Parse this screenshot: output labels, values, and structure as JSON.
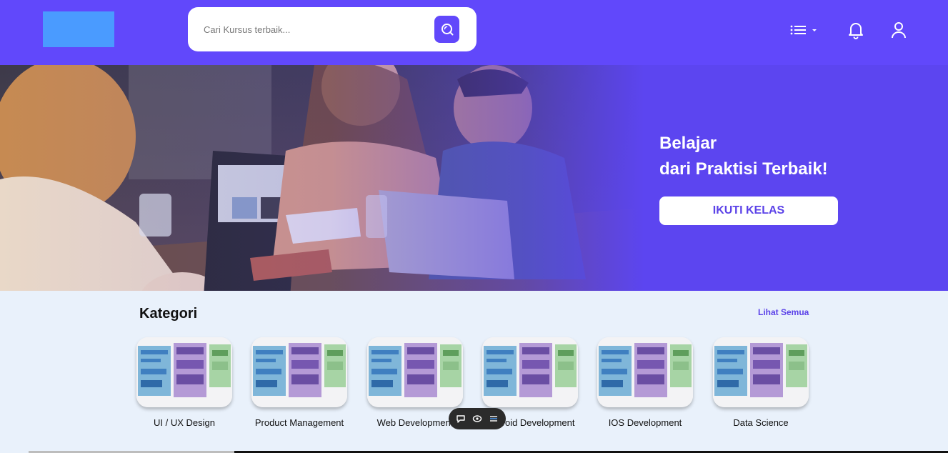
{
  "header": {
    "search": {
      "placeholder": "Cari Kursus terbaik..."
    },
    "colors": {
      "brand": "#6148fb",
      "logo": "#4a9bff"
    }
  },
  "hero": {
    "title_line1": "Belajar",
    "title_line2": "dari Praktisi Terbaik!",
    "cta_label": "IKUTI KELAS"
  },
  "kategori": {
    "title": "Kategori",
    "see_all": "Lihat Semua",
    "items": [
      {
        "label": "UI / UX Design"
      },
      {
        "label": "Product Management"
      },
      {
        "label": "Web Development"
      },
      {
        "label": "Android Development"
      },
      {
        "label": "IOS Development"
      },
      {
        "label": "Data Science"
      }
    ]
  },
  "icons": [
    "search-icon",
    "menu-list-icon",
    "bell-icon",
    "user-icon",
    "chat-icon",
    "eye-icon",
    "list-icon"
  ]
}
